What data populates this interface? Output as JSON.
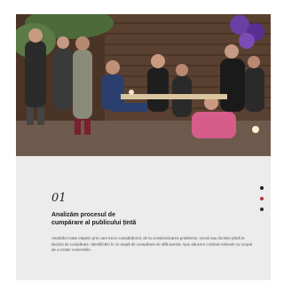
{
  "card": {
    "number": "01",
    "title_line1": "Analizăm procesul de",
    "title_line2": "cumpărare al publicului țintă",
    "description": "Analizăm toate etapele prin care trece cumpărătorul, de la conștientizarea problemei, nevoii sau dorinței până la decizia de cumpărare. Identificăm în ce etapă de cumpărare se află acesta. Apoi aducem conținut relevant cu scopul de a crește conversiile."
  },
  "colors": {
    "card_background": "#ececec",
    "dot_active": "#1b1b2e",
    "dot_accent": "#b5323c",
    "dot_inactive": "#2a2a3e",
    "balloon_purple": "#6b3fa6"
  },
  "carousel": {
    "dot_count": 3,
    "active_index": 0
  }
}
